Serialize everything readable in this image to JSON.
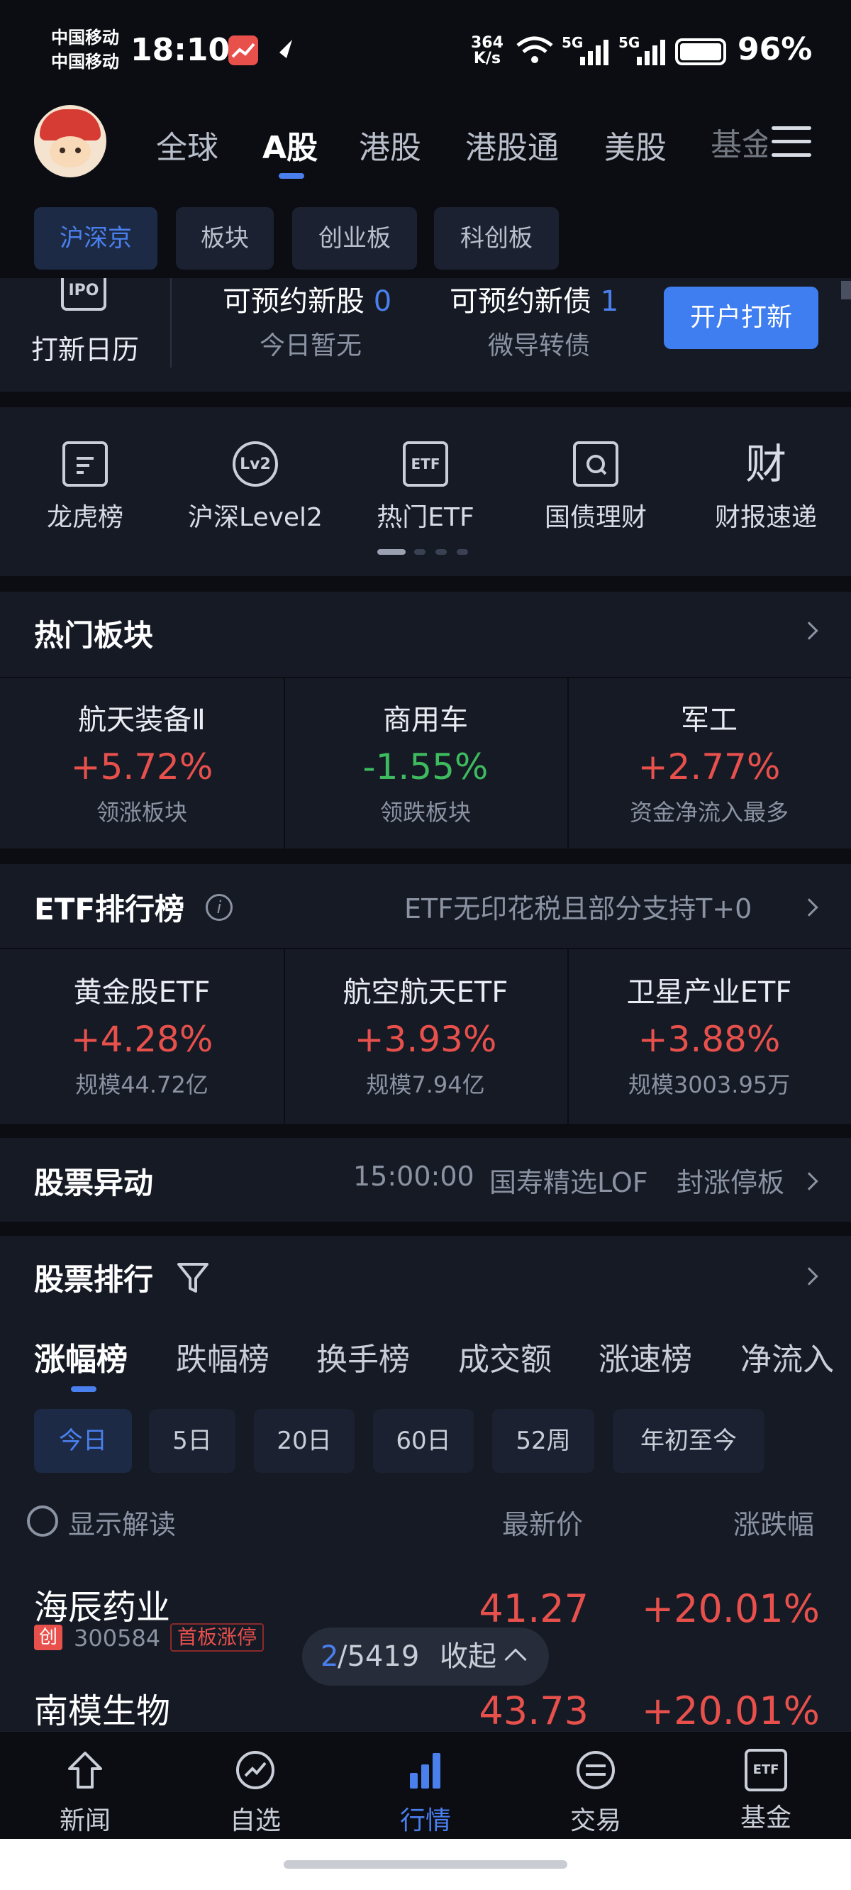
{
  "status": {
    "carrier1": "中国移动",
    "carrier2": "中国移动",
    "time": "18:10",
    "speed_top": "364",
    "speed_bottom": "K/s",
    "net1": "5G",
    "net2": "5G",
    "battery": "96%"
  },
  "topnav": {
    "tabs": [
      "全球",
      "A股",
      "港股",
      "港股通",
      "美股",
      "基金"
    ],
    "active": 1
  },
  "subtabs": {
    "items": [
      "沪深京",
      "板块",
      "创业板",
      "科创板"
    ],
    "active": 0
  },
  "ipo": {
    "calendar_label": "打新日历",
    "calendar_icon": "IPO",
    "new_stocks_label": "可预约新股",
    "new_stocks_count": "0",
    "new_stocks_sub": "今日暂无",
    "new_bonds_label": "可预约新债",
    "new_bonds_count": "1",
    "new_bonds_sub": "微导转债",
    "open_button": "开户打新"
  },
  "quick": {
    "items": [
      {
        "label": "龙虎榜",
        "icon": "list-doc-icon"
      },
      {
        "label": "沪深Level2",
        "icon": "lv2-icon"
      },
      {
        "label": "热门ETF",
        "icon": "etf-icon"
      },
      {
        "label": "国债理财",
        "icon": "bond-icon"
      },
      {
        "label": "财报速递",
        "icon": "finance-report-icon"
      }
    ],
    "level2_glyph": "Lv2",
    "etf_glyph": "ETF",
    "cai_glyph": "财"
  },
  "hot_sectors": {
    "title": "热门板块",
    "items": [
      {
        "name": "航天装备Ⅱ",
        "value": "+5.72%",
        "sub": "领涨板块",
        "color": "red"
      },
      {
        "name": "商用车",
        "value": "-1.55%",
        "sub": "领跌板块",
        "color": "green"
      },
      {
        "name": "军工",
        "value": "+2.77%",
        "sub": "资金净流入最多",
        "color": "red"
      }
    ]
  },
  "etf": {
    "title": "ETF排行榜",
    "note": "ETF无印花税且部分支持T+0",
    "items": [
      {
        "name": "黄金股ETF",
        "value": "+4.28%",
        "sub": "规模44.72亿"
      },
      {
        "name": "航空航天ETF",
        "value": "+3.93%",
        "sub": "规模7.94亿"
      },
      {
        "name": "卫星产业ETF",
        "value": "+3.88%",
        "sub": "规模3003.95万"
      }
    ]
  },
  "movement": {
    "title": "股票异动",
    "time": "15:00:00",
    "stock": "国寿精选LOF",
    "event": "封涨停板"
  },
  "ranking": {
    "title": "股票排行",
    "tabs": [
      "涨幅榜",
      "跌幅榜",
      "换手榜",
      "成交额",
      "涨速榜",
      "净流入"
    ],
    "periods": [
      "今日",
      "5日",
      "20日",
      "60日",
      "52周",
      "年初至今"
    ],
    "show_interpret": "显示解读",
    "col_price": "最新价",
    "col_change": "涨跌幅",
    "rows": [
      {
        "name": "海辰药业",
        "board": "创",
        "code": "300584",
        "tag": "首板涨停",
        "price": "41.27",
        "change": "+20.01%"
      },
      {
        "name": "南模生物",
        "price": "43.73",
        "change": "+20.01%"
      }
    ],
    "page_current": "2",
    "page_total": "/5419",
    "collapse": "收起"
  },
  "bottom_nav": {
    "items": [
      "新闻",
      "自选",
      "行情",
      "交易",
      "基金"
    ],
    "active": 2,
    "fund_glyph": "ETF"
  }
}
